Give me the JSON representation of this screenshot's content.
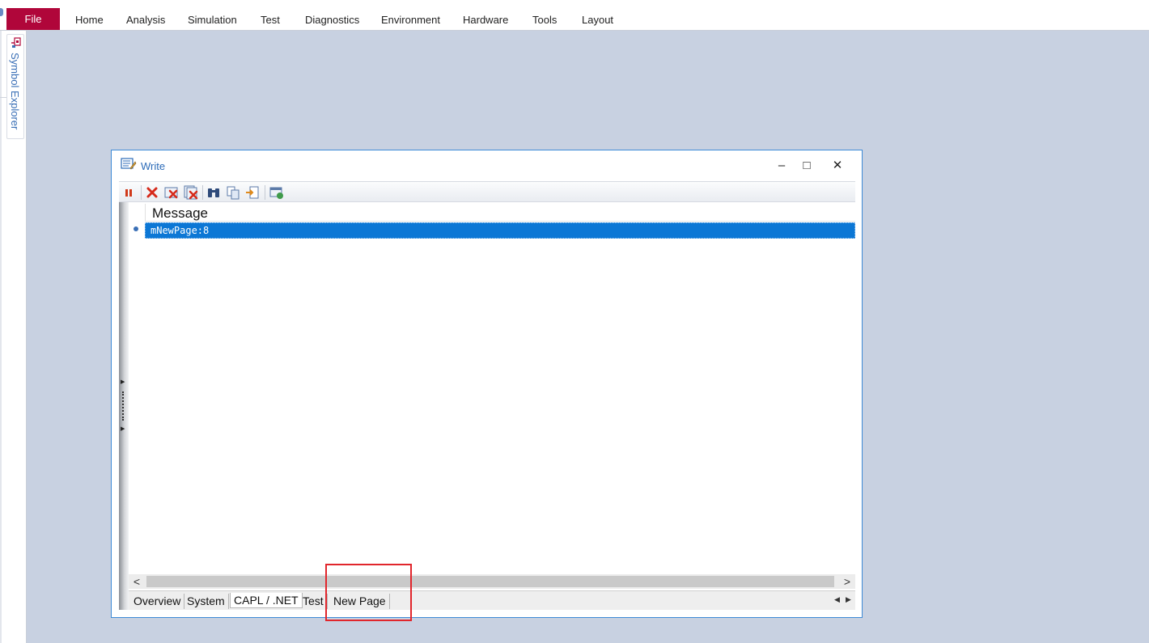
{
  "menu": {
    "file": "File",
    "items": [
      "Home",
      "Analysis",
      "Simulation",
      "Test",
      "Diagnostics",
      "Environment",
      "Hardware",
      "Tools",
      "Layout"
    ]
  },
  "side_panel": {
    "label": "Symbol Explorer",
    "icon": "symbol-explorer-icon"
  },
  "window": {
    "title": "Write",
    "icon": "write-window-icon",
    "controls": {
      "minimize": "–",
      "maximize": "□",
      "close": "✕"
    },
    "toolbar": [
      {
        "name": "pause",
        "icon": "pause-icon"
      },
      {
        "name": "delete",
        "icon": "delete-icon"
      },
      {
        "name": "clear-page",
        "icon": "clear-page-icon"
      },
      {
        "name": "clear-all",
        "icon": "clear-all-icon"
      },
      {
        "name": "find",
        "icon": "binoculars-icon"
      },
      {
        "name": "copy",
        "icon": "copy-icon"
      },
      {
        "name": "export",
        "icon": "export-icon"
      },
      {
        "name": "configure",
        "icon": "configure-icon"
      }
    ],
    "column_header": "Message",
    "rows": [
      {
        "text": "mNewPage:8",
        "selected": true
      }
    ],
    "scroll": {
      "left": "<",
      "right": ">"
    },
    "tabs": [
      "Overview",
      "System",
      "CAPL / .NET",
      "Test",
      "New Page"
    ],
    "active_tab": "CAPL / .NET",
    "tab_nav": {
      "prev": "◀",
      "next": "▶"
    }
  },
  "colors": {
    "file_button": "#b0063a",
    "workspace": "#c8d1e1",
    "selection": "#0c77d5",
    "window_border": "#3d8ad6",
    "highlight": "#e1262c"
  }
}
